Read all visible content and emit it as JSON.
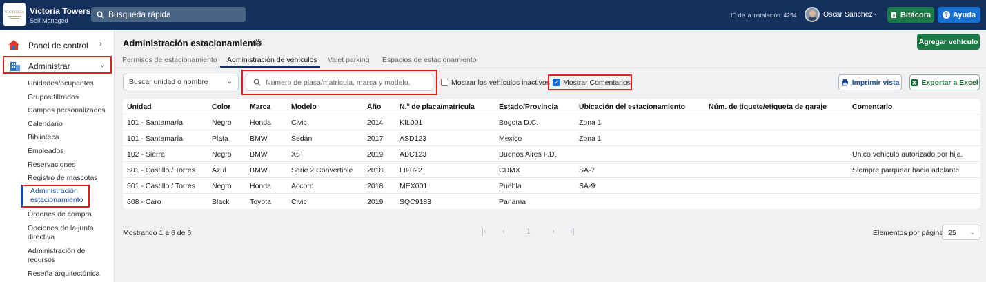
{
  "header": {
    "brand_name": "Victoria Towers",
    "brand_sub": "Self Managed",
    "search_label": "Búsqueda rápida",
    "install_id": "ID de la instalación: 4254",
    "user_name": "Oscar Sanchez",
    "bitacora": "Bitácora",
    "ayuda": "Ayuda"
  },
  "sidebar": {
    "panel": "Panel de control",
    "administrar": "Administrar",
    "items": [
      "Unidades/ocupantes",
      "Grupos filtrados",
      "Campos personalizados",
      "Calendario",
      "Biblioteca",
      "Empleados",
      "Reservaciones",
      "Registro de mascotas",
      "Administración estacionamiento",
      "Órdenes de compra",
      "Opciones de la junta directiva",
      "Administración de recursos",
      "Reseña arquitectónica"
    ]
  },
  "main": {
    "title": "Administración estacionamiento",
    "add_button": "Agregar vehículo",
    "tabs": [
      "Permisos de estacionamiento",
      "Administración de vehículos",
      "Valet parking",
      "Espacios de estacionamiento"
    ],
    "unit_select": "Buscar unidad o nombre",
    "search_placeholder": "Número de placa/matrícula, marca y modelo, año",
    "show_inactive": "Mostrar los vehículos inactivos",
    "show_comments": "Mostrar Comentarios",
    "print": "Imprimir vista",
    "export": "Exportar a Excel"
  },
  "table": {
    "headers": [
      "Unidad",
      "Color",
      "Marca",
      "Modelo",
      "Año",
      "N.º de placa/matrícula",
      "Estado/Provincia",
      "Ubicación del estacionamiento",
      "Núm. de tiquete/etiqueta de garaje",
      "Comentario"
    ],
    "rows": [
      [
        "101 - Santamaría",
        "Negro",
        "Honda",
        "Civic",
        "2014",
        "KIL001",
        "Bogota D.C.",
        "Zona 1",
        "",
        ""
      ],
      [
        "101 - Santamaría",
        "Plata",
        "BMW",
        "Sedán",
        "2017",
        "ASD123",
        "Mexico",
        "Zona 1",
        "",
        ""
      ],
      [
        "102 - Sierra",
        "Negro",
        "BMW",
        "X5",
        "2019",
        "ABC123",
        "Buenos Aires F.D.",
        "",
        "",
        "Unico vehiculo autorizado por hija."
      ],
      [
        "501 - Castillo / Torres",
        "Azul",
        "BMW",
        "Serie 2 Convertible",
        "2018",
        "LIF022",
        "CDMX",
        "SA-7",
        "",
        "Siempre parquear hacia adelante"
      ],
      [
        "501 - Castillo / Torres",
        "Negro",
        "Honda",
        "Accord",
        "2018",
        "MEX001",
        "Puebla",
        "SA-9",
        "",
        ""
      ],
      [
        "608 - Caro",
        "Black",
        "Toyota",
        "Civic",
        "2019",
        "SQC9183",
        "Panama",
        "",
        "",
        ""
      ]
    ]
  },
  "footer": {
    "showing": "Mostrando 1 a 6 de 6",
    "page": "1",
    "per_page_label": "Elementos por página",
    "per_page_value": "25"
  }
}
